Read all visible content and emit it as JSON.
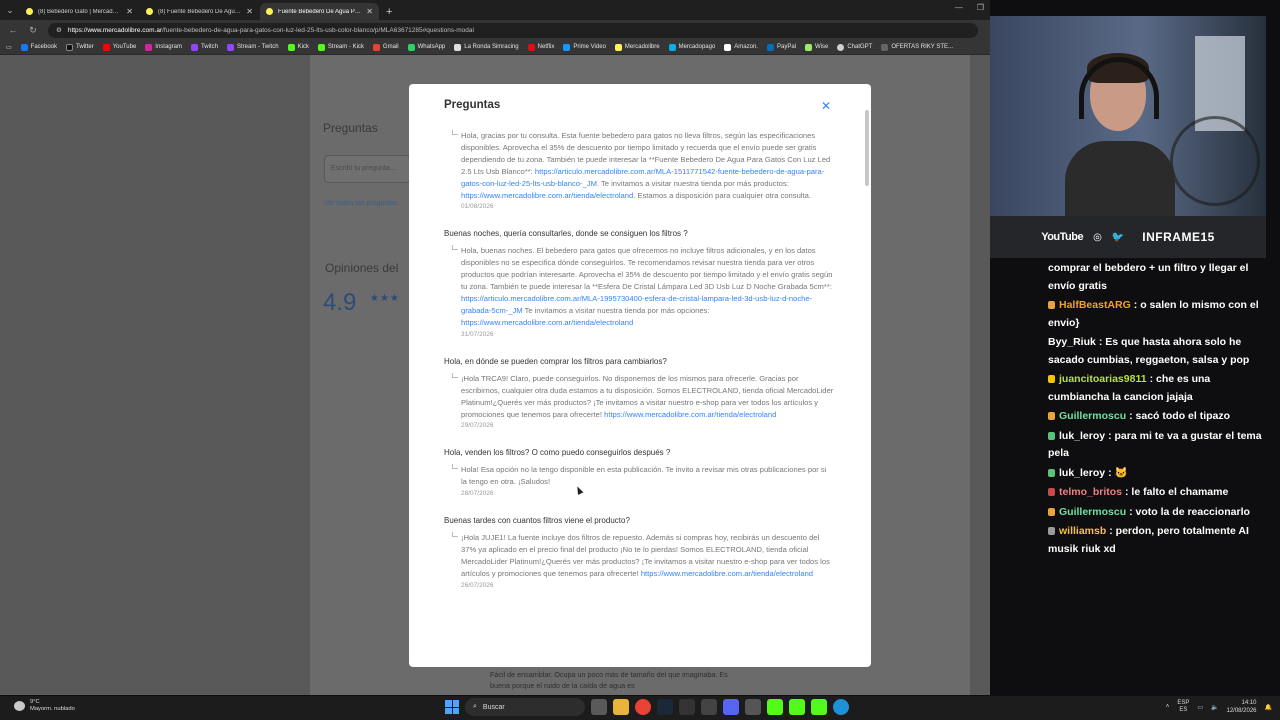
{
  "browser": {
    "tabs": [
      {
        "label": "(8) Bebedero Gato | MercadoLibre",
        "active": false
      },
      {
        "label": "(8) Fuente Bebedero De Agua Para Gatos",
        "active": false
      },
      {
        "label": "Fuente Bebedero De Agua Para Gatos",
        "active": true
      }
    ],
    "url_host": "https://www.mercadolibre.com.ar",
    "url_path": "/fuente-bebedero-de-agua-para-gatos-con-luz-led-25-lts-usb-color-blanco/p/MLA63671285#questions-modal",
    "bookmarks": [
      "Facebook",
      "Twitter",
      "YouTube",
      "Instagram",
      "Twitch",
      "Stream - Twitch",
      "Kick",
      "Stream - Kick",
      "Gmail",
      "WhatsApp",
      "La Ronda Simracing",
      "Netflix",
      "Prime Video",
      "Mercadolibre",
      "Mercadopago",
      "Amazon.",
      "PayPal",
      "Wise",
      "ChatGPT",
      "OFERTAS RIKY STE..."
    ]
  },
  "background_page": {
    "heading_questions": "Preguntas",
    "question_placeholder": "Escribí tu pregunta...",
    "see_all_link": "Ver todas las preguntas",
    "heading_reviews": "Opiniones del",
    "rating": "4.9",
    "under_modal_text": "Fácil de ensamblar. Ocupa un poco más de tamaño del que imaginaba. Es buena porque el ruido de la caída de agua es"
  },
  "modal": {
    "title": "Preguntas",
    "qa": [
      {
        "question": "",
        "answer_text": "Hola, gracias por tu consulta. Esta fuente bebedero para gatos no lleva filtros, según las especificaciones disponibles. Aprovecha el 35% de descuento por tiempo limitado y recuerda que el envío puede ser gratis dependiendo de tu zona. También te puede interesar la **Fuente Bebedero De Agua Para Gatos Con Luz Led 2.5 Lts Usb Blanco**: ",
        "answer_link1": "https://articulo.mercadolibre.com.ar/MLA-1511771542-fuente-bebedero-de-agua-para-gatos-con-luz-led-25-lts-usb-blanco-_JM",
        "answer_mid": ". Te invitamos a visitar nuestra tienda por más productos: ",
        "answer_link2": "https://www.mercadolibre.com.ar/tienda/electroland",
        "answer_end": ". Estamos a disposición para cualquier otra consulta.",
        "date": "01/08/2026"
      },
      {
        "question": "Buenas noches, quería consultarles, donde se consiguen los filtros ?",
        "answer_text": "Hola, buenas noches. El bebedero para gatos que ofrecemos no incluye filtros adicionales, y en los datos disponibles no se especifica dónde conseguirlos. Te recomendamos revisar nuestra tienda para ver otros productos que podrían interesarte. Aprovecha el 35% de descuento por tiempo limitado y el envío gratis según tu zona. También te puede interesar la **Esfera De Cristal Lámpara Led 3D Usb Luz D Noche Grabada 5cm**: ",
        "answer_link1": "https://articulo.mercadolibre.com.ar/MLA-1995730400-esfera-de-cristal-lampara-led-3d-usb-luz-d-noche-grabada-5cm-_JM",
        "answer_mid": " Te invitamos a visitar nuestra tienda por más opciones: ",
        "answer_link2": "https://www.mercadolibre.com.ar/tienda/electroland",
        "answer_end": "",
        "date": "31/07/2026"
      },
      {
        "question": "Hola, en dónde se pueden comprar los filtros para cambiarlos?",
        "answer_text": "¡Hola TRCA9! Claro, puede conseguirlos. No disponemos de los mismos para ofrecerle. Gracias por escribirnos, cualquier otra duda estamos a tu disposición. Somos ELECTROLAND, tienda oficial MercadoLider Platinum!¿Querés ver más productos? ¡Te invitamos a visitar nuestro e-shop para ver todos los artículos y promociones que tenemos para ofrecerte! ",
        "answer_link1": "https://www.mercadolibre.com.ar/tienda/electroland",
        "answer_mid": "",
        "answer_link2": "",
        "answer_end": "",
        "date": "29/07/2026"
      },
      {
        "question": "Hola, venden los filtros? O como puedo conseguirlos después ?",
        "answer_text": "Hola! Esa opción no la tengo disponible en esta publicación. Te invito a revisar mis otras publicaciones por si la tengo en otra. ¡Saludos!",
        "answer_link1": "",
        "answer_mid": "",
        "answer_link2": "",
        "answer_end": "",
        "date": "28/07/2026"
      },
      {
        "question": "Buenas tardes con cuantos filtros viene el producto?",
        "answer_text": "¡Hola JUJE1! La fuente incluye dos filtros de repuesto. Además si compras hoy, recibirás un descuento del 37% ya aplicado en el precio final del producto ¡No te lo pierdas! Somos ELECTROLAND, tienda oficial MercadoLider Platinum!¿Querés ver más productos? ¡Te invitamos a visitar nuestro e-shop para ver todos los artículos y promociones que tenemos para ofrecerte! ",
        "answer_link1": "https://www.mercadolibre.com.ar/tienda/electroland",
        "answer_mid": "",
        "answer_link2": "",
        "answer_end": "",
        "date": "26/07/2026"
      }
    ]
  },
  "stream": {
    "social_youtube": "YouTube",
    "handle": "INFRAME15",
    "chat": [
      {
        "user": "",
        "color": "#ffffff",
        "badge": "",
        "text": "comprar el bebdero + un filtro y llegar el envío gratis"
      },
      {
        "user": "HalfBeastARG",
        "color": "#f0a229",
        "badge": "#e8a33b",
        "text": ": o salen lo mismo con el envio}"
      },
      {
        "user": "Byy_Riuk",
        "color": "#ffffff",
        "badge": "",
        "text": ": Es que hasta ahora solo he sacado cumbias, reggaeton, salsa y pop"
      },
      {
        "user": "juancitoarias9811",
        "color": "#b5e43b",
        "badge": "#f5c400",
        "text": ": che es una cumbiancha la cancion jajaja"
      },
      {
        "user": "Guillermoscu",
        "color": "#6ee0a0",
        "badge": "#e8a33b",
        "text": ": sacó todo el tipazo"
      },
      {
        "user": "luk_leroy",
        "color": "#ffffff",
        "badge": "#5bc27a",
        "text": ": para mi te va a gustar el tema pela"
      },
      {
        "user": "luk_leroy",
        "color": "#ffffff",
        "badge": "#5bc27a",
        "text": ": 🐱"
      },
      {
        "user": "telmo_britos",
        "color": "#f07f7f",
        "badge": "#c94a4a",
        "text": ": le falto el chamame"
      },
      {
        "user": "Guillermoscu",
        "color": "#6ee0a0",
        "badge": "#e8a33b",
        "text": ": voto la de reaccionarlo"
      },
      {
        "user": "williamsb",
        "color": "#f3c04a",
        "badge": "#9a9a9a",
        "text": ": perdon, pero totalmente AI musik riuk xd"
      }
    ]
  },
  "taskbar": {
    "weather_temp": "9°C",
    "weather_desc": "Mayorm. nublado",
    "search_label": "Buscar",
    "lang_top": "ESP",
    "lang_bottom": "ES",
    "time": "14:10",
    "date": "12/08/2026"
  }
}
